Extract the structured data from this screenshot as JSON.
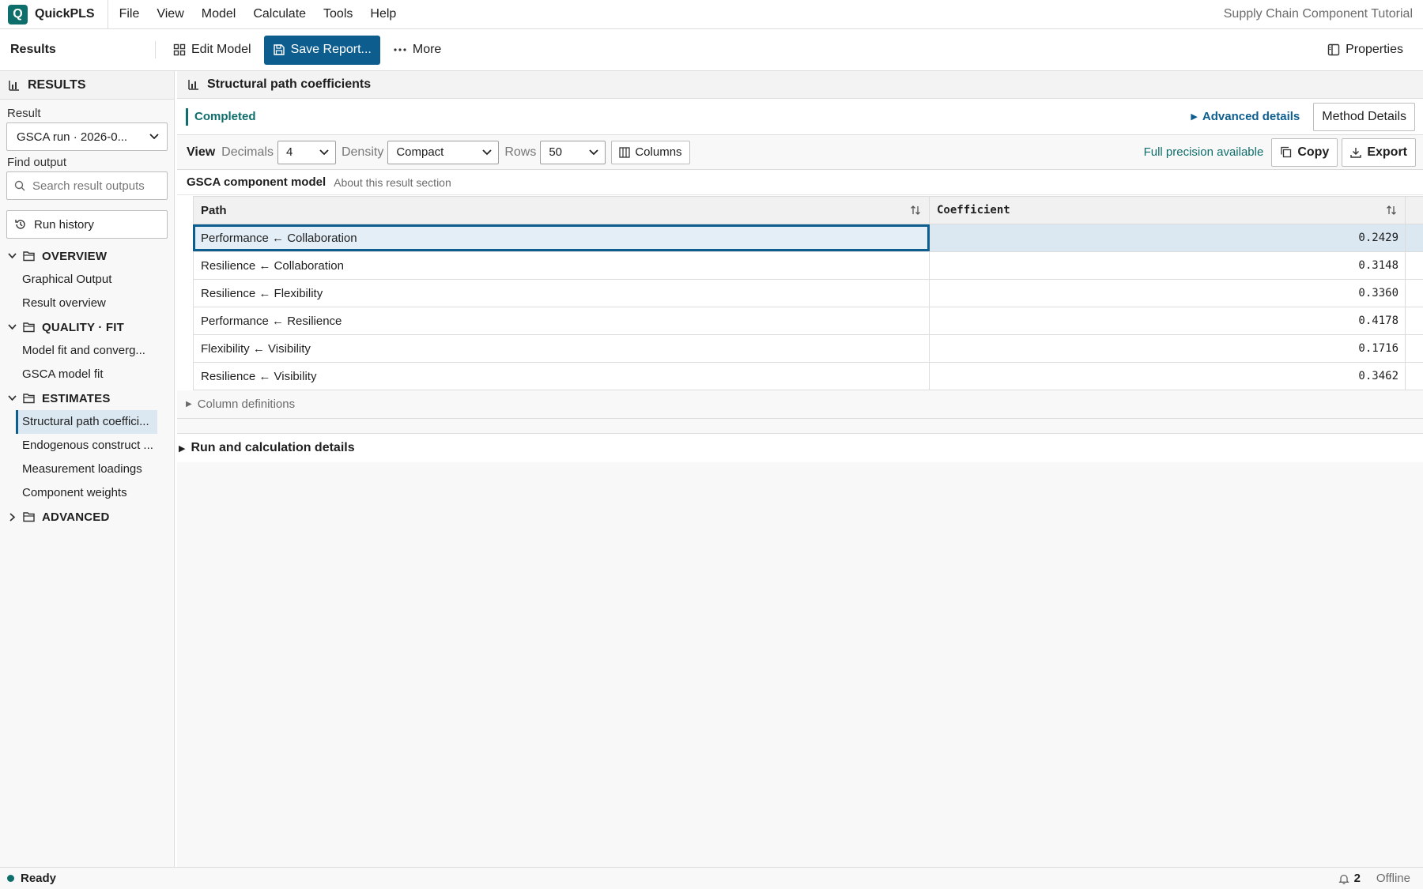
{
  "app": {
    "name": "QuickPLS",
    "logo_letter": "Q",
    "document_title": "Supply Chain Component Tutorial"
  },
  "menu": [
    "File",
    "View",
    "Model",
    "Calculate",
    "Tools",
    "Help"
  ],
  "toolbar": {
    "title": "Results",
    "edit_model": "Edit Model",
    "save_report": "Save Report...",
    "more": "More",
    "properties": "Properties"
  },
  "sidebar": {
    "heading": "RESULTS",
    "result_label": "Result",
    "result_value": "GSCA run · 2026-0...",
    "find_label": "Find output",
    "search_placeholder": "Search result outputs",
    "run_history": "Run history",
    "groups": [
      {
        "label": "OVERVIEW",
        "expanded": true,
        "items": [
          "Graphical Output",
          "Result overview"
        ]
      },
      {
        "label": "QUALITY · FIT",
        "expanded": true,
        "items": [
          "Model fit and converg...",
          "GSCA model fit"
        ]
      },
      {
        "label": "ESTIMATES",
        "expanded": true,
        "items": [
          "Structural path coeffici...",
          "Endogenous construct ...",
          "Measurement loadings",
          "Component weights"
        ]
      },
      {
        "label": "ADVANCED",
        "expanded": false,
        "items": []
      }
    ]
  },
  "main": {
    "section_title": "Structural path coefficients",
    "status": "Completed",
    "advanced_details": "Advanced details",
    "method_details": "Method Details",
    "view": {
      "label": "View",
      "decimals_label": "Decimals",
      "decimals_value": "4",
      "density_label": "Density",
      "density_value": "Compact",
      "rows_label": "Rows",
      "rows_value": "50",
      "columns_btn": "Columns",
      "precision_note": "Full precision available",
      "copy": "Copy",
      "export": "Export"
    },
    "model_title": "GSCA component model",
    "model_about": "About this result section",
    "table": {
      "headers": [
        "Path",
        "Coefficient"
      ],
      "rows": [
        {
          "path": "Performance ← Collaboration",
          "coef": "0.2429"
        },
        {
          "path": "Resilience ← Collaboration",
          "coef": "0.3148"
        },
        {
          "path": "Resilience ← Flexibility",
          "coef": "0.3360"
        },
        {
          "path": "Performance ← Resilience",
          "coef": "0.4178"
        },
        {
          "path": "Flexibility ← Visibility",
          "coef": "0.1716"
        },
        {
          "path": "Resilience ← Visibility",
          "coef": "0.3462"
        }
      ]
    },
    "column_definitions": "Column definitions",
    "run_details": "Run and calculation details"
  },
  "statusbar": {
    "state": "Ready",
    "notifications": "2",
    "connection": "Offline"
  },
  "colors": {
    "brand": "#0e6e6b",
    "primary": "#0d5e8e",
    "selected_row": "#dbe8f2"
  }
}
